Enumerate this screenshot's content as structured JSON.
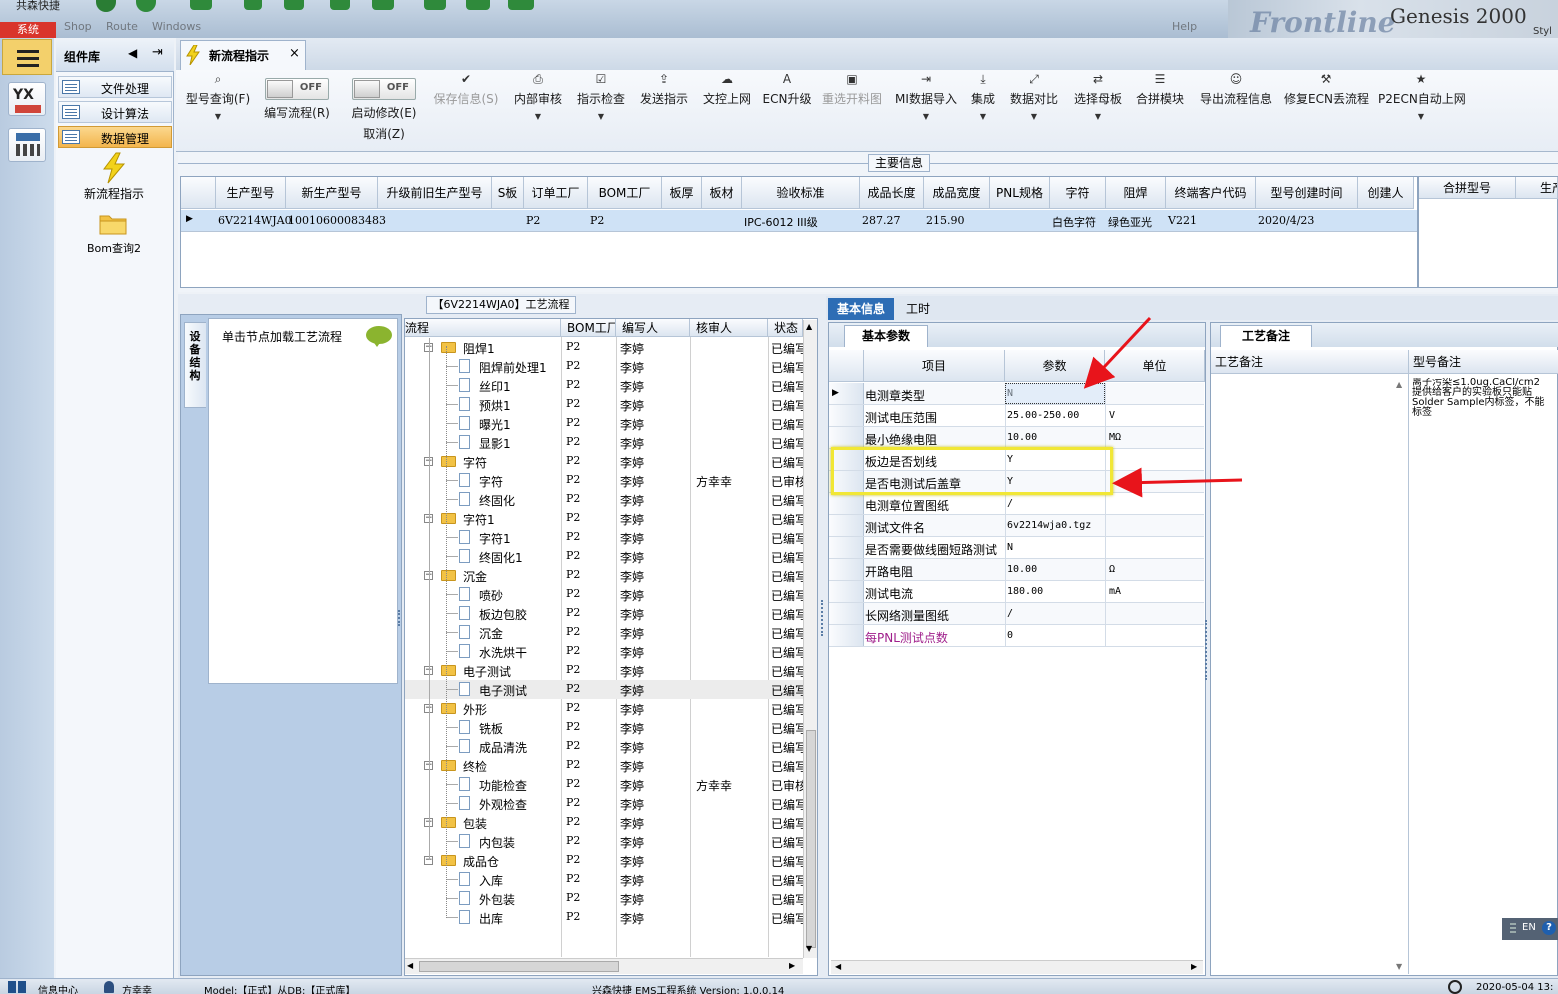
{
  "window": {
    "system_button": "系统",
    "strip_words": [
      "共森快捷",
      "Shop",
      "Route",
      "Windows",
      "Help"
    ],
    "brand_name": "Frontline",
    "brand_product": "Genesis 2000",
    "brand_style_fragment": "Styl"
  },
  "library": {
    "title": "组件库",
    "items": [
      {
        "label": "文件处理",
        "selected": false
      },
      {
        "label": "设计算法",
        "selected": false
      },
      {
        "label": "数据管理",
        "selected": true
      }
    ],
    "launchers": [
      {
        "label": "新流程指示",
        "icon": "lightning-icon"
      },
      {
        "label": "Bom查询2",
        "icon": "folder-icon"
      }
    ]
  },
  "tabs": [
    {
      "label": "新流程指示",
      "close": "×"
    }
  ],
  "toolbar": {
    "buttons": [
      {
        "label": "型号查询(F)",
        "icon": "search-icon",
        "dropdown": true,
        "disabled": false
      },
      {
        "label": "编写流程(R)",
        "toggle": "OFF",
        "disabled": false
      },
      {
        "label": "启动修改(E)",
        "sublabel": "取消(Z)",
        "toggle": "OFF",
        "disabled": false
      },
      {
        "label": "保存信息(S)",
        "icon": "check-icon",
        "disabled": true
      },
      {
        "label": "内部审核",
        "icon": "print-icon",
        "dropdown": true,
        "disabled": false
      },
      {
        "label": "指示检查",
        "icon": "checkbox-icon",
        "dropdown": true,
        "disabled": false
      },
      {
        "label": "发送指示",
        "icon": "upload-icon",
        "disabled": false
      },
      {
        "label": "文控上网",
        "icon": "cloud-upload-icon",
        "disabled": false
      },
      {
        "label": "ECN升级",
        "icon": "ecn-icon",
        "disabled": false
      },
      {
        "label": "重选开料图",
        "icon": "image-icon",
        "disabled": true
      },
      {
        "label": "MI数据导入",
        "icon": "import-icon",
        "dropdown": true,
        "disabled": false
      },
      {
        "label": "集成",
        "icon": "download-icon",
        "dropdown": true,
        "disabled": false
      },
      {
        "label": "数据对比",
        "icon": "compare-icon",
        "dropdown": true,
        "disabled": false
      },
      {
        "label": "选择母板",
        "icon": "shuffle-icon",
        "dropdown": true,
        "disabled": false
      },
      {
        "label": "合拼模块",
        "icon": "list-icon",
        "disabled": false
      },
      {
        "label": "导出流程信息",
        "icon": "smile-icon",
        "disabled": false
      },
      {
        "label": "修复ECN丢流程",
        "icon": "wrench-icon",
        "disabled": false
      },
      {
        "label": "P2ECN自动上网",
        "icon": "star-icon",
        "dropdown": true,
        "disabled": false
      }
    ]
  },
  "main_info": {
    "title": "主要信息",
    "columns": [
      "生产型号",
      "新生产型号",
      "升级前旧生产型号",
      "S板",
      "订单工厂",
      "BOM工厂",
      "板厚",
      "板材",
      "验收标准",
      "成品长度",
      "成品宽度",
      "PNL规格",
      "字符",
      "阻焊",
      "终端客户代码",
      "型号创建时间",
      "创建人"
    ],
    "row": [
      "6V2214WJA0",
      "10010600083483",
      "",
      "",
      "P2",
      "P2",
      "",
      "",
      "IPC-6012 III级",
      "287.27",
      "215.90",
      "",
      "白色字符",
      "绿色亚光",
      "V221",
      "2020/4/23",
      ""
    ],
    "side_columns": [
      "合拼型号",
      "生产"
    ]
  },
  "process": {
    "title": "【6V2214WJA0】工艺流程",
    "left_vertical_tab": "设备结构",
    "load_hint": "单击节点加载工艺流程",
    "columns": [
      "流程",
      "BOM工厂",
      "编写人",
      "核审人",
      "状态"
    ],
    "rows": [
      {
        "name": "阻焊1",
        "type": "folder",
        "bom": "P2",
        "writer": "李婷",
        "reviewer": "",
        "status": "已编写"
      },
      {
        "name": "阻焊前处理1",
        "type": "doc",
        "bom": "P2",
        "writer": "李婷",
        "reviewer": "",
        "status": "已编写"
      },
      {
        "name": "丝印1",
        "type": "doc",
        "bom": "P2",
        "writer": "李婷",
        "reviewer": "",
        "status": "已编写"
      },
      {
        "name": "预烘1",
        "type": "doc",
        "bom": "P2",
        "writer": "李婷",
        "reviewer": "",
        "status": "已编写"
      },
      {
        "name": "曝光1",
        "type": "doc",
        "bom": "P2",
        "writer": "李婷",
        "reviewer": "",
        "status": "已编写"
      },
      {
        "name": "显影1",
        "type": "doc",
        "bom": "P2",
        "writer": "李婷",
        "reviewer": "",
        "status": "已编写"
      },
      {
        "name": "字符",
        "type": "folder",
        "bom": "P2",
        "writer": "李婷",
        "reviewer": "",
        "status": "已编写"
      },
      {
        "name": "字符",
        "type": "doc",
        "bom": "P2",
        "writer": "李婷",
        "reviewer": "方幸幸",
        "status": "已审核"
      },
      {
        "name": "终固化",
        "type": "doc",
        "bom": "P2",
        "writer": "李婷",
        "reviewer": "",
        "status": "已编写"
      },
      {
        "name": "字符1",
        "type": "folder",
        "bom": "P2",
        "writer": "李婷",
        "reviewer": "",
        "status": "已编写"
      },
      {
        "name": "字符1",
        "type": "doc",
        "bom": "P2",
        "writer": "李婷",
        "reviewer": "",
        "status": "已编写"
      },
      {
        "name": "终固化1",
        "type": "doc",
        "bom": "P2",
        "writer": "李婷",
        "reviewer": "",
        "status": "已编写"
      },
      {
        "name": "沉金",
        "type": "folder",
        "bom": "P2",
        "writer": "李婷",
        "reviewer": "",
        "status": "已编写"
      },
      {
        "name": "喷砂",
        "type": "doc",
        "bom": "P2",
        "writer": "李婷",
        "reviewer": "",
        "status": "已编写"
      },
      {
        "name": "板边包胶",
        "type": "doc",
        "bom": "P2",
        "writer": "李婷",
        "reviewer": "",
        "status": "已编写"
      },
      {
        "name": "沉金",
        "type": "doc",
        "bom": "P2",
        "writer": "李婷",
        "reviewer": "",
        "status": "已编写"
      },
      {
        "name": "水洗烘干",
        "type": "doc",
        "bom": "P2",
        "writer": "李婷",
        "reviewer": "",
        "status": "已编写"
      },
      {
        "name": "电子测试",
        "type": "folder",
        "bom": "P2",
        "writer": "李婷",
        "reviewer": "",
        "status": "已编写"
      },
      {
        "name": "电子测试",
        "type": "doc",
        "bom": "P2",
        "writer": "李婷",
        "reviewer": "",
        "status": "已编写",
        "selected": true
      },
      {
        "name": "外形",
        "type": "folder",
        "bom": "P2",
        "writer": "李婷",
        "reviewer": "",
        "status": "已编写"
      },
      {
        "name": "铣板",
        "type": "doc",
        "bom": "P2",
        "writer": "李婷",
        "reviewer": "",
        "status": "已编写"
      },
      {
        "name": "成品清洗",
        "type": "doc",
        "bom": "P2",
        "writer": "李婷",
        "reviewer": "",
        "status": "已编写"
      },
      {
        "name": "终检",
        "type": "folder",
        "bom": "P2",
        "writer": "李婷",
        "reviewer": "",
        "status": "已编写"
      },
      {
        "name": "功能检查",
        "type": "doc",
        "bom": "P2",
        "writer": "李婷",
        "reviewer": "方幸幸",
        "status": "已审核"
      },
      {
        "name": "外观检查",
        "type": "doc",
        "bom": "P2",
        "writer": "李婷",
        "reviewer": "",
        "status": "已编写"
      },
      {
        "name": "包装",
        "type": "folder",
        "bom": "P2",
        "writer": "李婷",
        "reviewer": "",
        "status": "已编写"
      },
      {
        "name": "内包装",
        "type": "doc",
        "bom": "P2",
        "writer": "李婷",
        "reviewer": "",
        "status": "已编写"
      },
      {
        "name": "成品仓",
        "type": "folder",
        "bom": "P2",
        "writer": "李婷",
        "reviewer": "",
        "status": "已编写"
      },
      {
        "name": "入库",
        "type": "doc",
        "bom": "P2",
        "writer": "李婷",
        "reviewer": "",
        "status": "已编写"
      },
      {
        "name": "外包装",
        "type": "doc",
        "bom": "P2",
        "writer": "李婷",
        "reviewer": "",
        "status": "已编写"
      },
      {
        "name": "出库",
        "type": "doc",
        "bom": "P2",
        "writer": "李婷",
        "reviewer": "",
        "status": "已编写"
      }
    ]
  },
  "basic": {
    "tabs": [
      "基本信息",
      "工时"
    ],
    "sub_tab": "基本参数",
    "columns": [
      "项目",
      "参数",
      "单位"
    ],
    "rows": [
      {
        "item": "电测章类型",
        "param": "N",
        "unit": ""
      },
      {
        "item": "测试电压范围",
        "param": "25.00-250.00",
        "unit": "V"
      },
      {
        "item": "最小绝缘电阻",
        "param": "10.00",
        "unit": "MΩ"
      },
      {
        "item": "板边是否划线",
        "param": "Y",
        "unit": ""
      },
      {
        "item": "是否电测试后盖章",
        "param": "Y",
        "unit": ""
      },
      {
        "item": "电测章位置图纸",
        "param": "/",
        "unit": ""
      },
      {
        "item": "测试文件名",
        "param": "6v2214wja0.tgz",
        "unit": ""
      },
      {
        "item": "是否需要做线圈短路测试",
        "param": "N",
        "unit": ""
      },
      {
        "item": "开路电阻",
        "param": "10.00",
        "unit": "Ω"
      },
      {
        "item": "测试电流",
        "param": "180.00",
        "unit": "mA"
      },
      {
        "item": "长网络测量图纸",
        "param": "/",
        "unit": ""
      },
      {
        "item": "每PNL测试点数",
        "param": "0",
        "unit": "",
        "highlight_color": "#a0208c"
      }
    ]
  },
  "notes": {
    "tab": "工艺备注",
    "columns": [
      "工艺备注",
      "型号备注"
    ],
    "model_note_lines": [
      "离子污染≤1.0ug.CaCl/cm2",
      "提供给客户的实验板只能贴",
      "Solder Sample内标签，不能",
      "标签"
    ]
  },
  "ime": {
    "label": "EN",
    "help": "?"
  },
  "status": {
    "items": [
      "信息中心",
      "方幸幸",
      "Model:【正式】从DB:【正式库】",
      "兴森快捷 EMS工程系统 Version: 1.0.0.14",
      "2020-05-04 13:"
    ]
  },
  "colors": {
    "accent": "#2d6db5",
    "selected_row": "#cfe2f6",
    "annotation_box": "#f1e735",
    "annotation_arrow": "#e8141b"
  }
}
